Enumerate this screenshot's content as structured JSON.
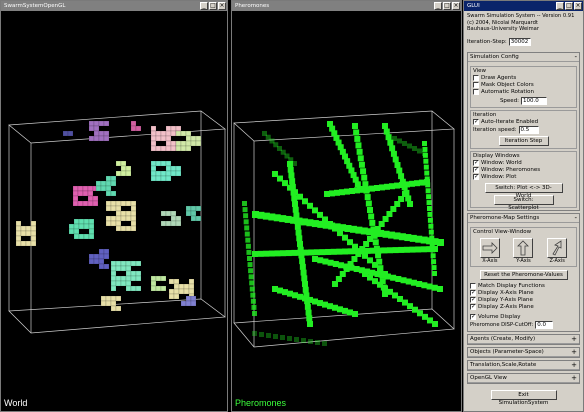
{
  "windows": {
    "world": {
      "title": "SwarmSystemOpenGL",
      "label": "World",
      "label_color": "#ffffff"
    },
    "pheromones": {
      "title": "Pheromones",
      "label": "Pheromones",
      "label_color": "#3cff3c"
    },
    "gui": {
      "title": "GLUI"
    }
  },
  "titlebar_buttons": [
    "_",
    "□",
    "×"
  ],
  "gui": {
    "header": {
      "line1": "Swarm Simulation System -- Version 0.91",
      "line2": "(c) 2004, Nicolai Marquardt",
      "line3": "Bauhaus-University Weimar"
    },
    "iteration_step": {
      "label": "Iteration-Step:",
      "value": "30002"
    },
    "simulation_config": {
      "title": "Simulation Config",
      "toggle": "-",
      "view": {
        "title": "View",
        "draw_agents": {
          "label": "Draw Agents",
          "checked": false
        },
        "mask_colors": {
          "label": "Mask Object Colors",
          "checked": false
        },
        "auto_rotation": {
          "label": "Automatic Rotation",
          "checked": false
        },
        "speed": {
          "label": "Speed:",
          "value": "100.0"
        }
      },
      "iteration": {
        "title": "Iteration",
        "auto_iterate": {
          "label": "Auto-Iterate Enabled",
          "checked": true
        },
        "speed": {
          "label": "Iteration speed:",
          "value": "0.5"
        },
        "step_button": "Iteration Step"
      },
      "display_windows": {
        "title": "Display Windows",
        "world": {
          "label": "Window: World",
          "checked": true
        },
        "pheromones": {
          "label": "Window: Pheromones",
          "checked": true
        },
        "plot": {
          "label": "Window: Plot",
          "checked": true
        },
        "switch_plot": "Switch: Plot <-> 3D-World",
        "switch_scatter": "Switch: Scatterplot"
      }
    },
    "pheromone_map": {
      "title": "Pheromone-Map Settings",
      "toggle": "-",
      "control_view": "Control View-Window",
      "axes": [
        "X-Axis",
        "Y-Axis",
        "Z-Axis"
      ],
      "reset_button": "Reset the Pheromone-Values",
      "match_display": {
        "label": "Match Display Functions",
        "checked": false
      },
      "display_x": {
        "label": "Display X-Axis Plane",
        "checked": true
      },
      "display_y": {
        "label": "Display Y-Axis Plane",
        "checked": true
      },
      "display_z": {
        "label": "Display Z-Axis Plane",
        "checked": true
      },
      "volume_display": {
        "label": "Volume Display",
        "checked": true
      },
      "cutoff": {
        "label": "Pheromone DISP-CutOff:",
        "value": "0.0"
      }
    },
    "collapsed": [
      {
        "title": "Agents (Create, Modify)",
        "toggle": "+"
      },
      {
        "title": "Objects (Parameter-Space)",
        "toggle": "+"
      },
      {
        "title": "Translation,Scale,Rotate",
        "toggle": "+"
      },
      {
        "title": "OpenGL View",
        "toggle": "+"
      }
    ],
    "exit_button": "Exit SimulationSystem"
  },
  "colors": {
    "titlebar_active": "#0a246a",
    "titlebar_inactive": "#808080",
    "panel_bg": "#d4d0c8",
    "pheromone_green": "#22ee22"
  }
}
